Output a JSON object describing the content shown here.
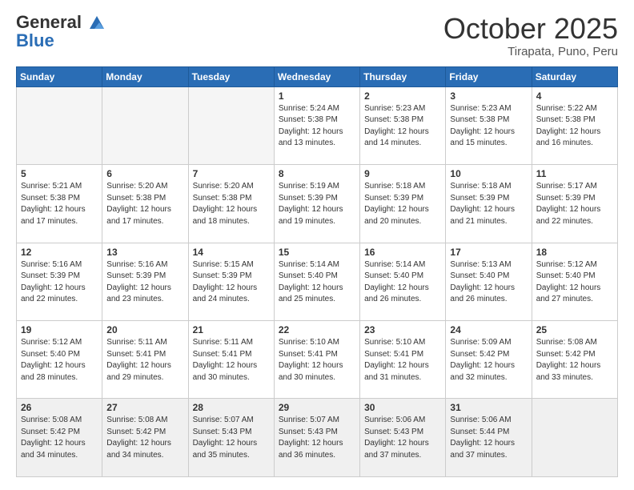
{
  "header": {
    "logo_general": "General",
    "logo_blue": "Blue",
    "month_title": "October 2025",
    "location": "Tirapata, Puno, Peru"
  },
  "days_of_week": [
    "Sunday",
    "Monday",
    "Tuesday",
    "Wednesday",
    "Thursday",
    "Friday",
    "Saturday"
  ],
  "weeks": [
    [
      {
        "day": "",
        "text": ""
      },
      {
        "day": "",
        "text": ""
      },
      {
        "day": "",
        "text": ""
      },
      {
        "day": "1",
        "text": "Sunrise: 5:24 AM\nSunset: 5:38 PM\nDaylight: 12 hours\nand 13 minutes."
      },
      {
        "day": "2",
        "text": "Sunrise: 5:23 AM\nSunset: 5:38 PM\nDaylight: 12 hours\nand 14 minutes."
      },
      {
        "day": "3",
        "text": "Sunrise: 5:23 AM\nSunset: 5:38 PM\nDaylight: 12 hours\nand 15 minutes."
      },
      {
        "day": "4",
        "text": "Sunrise: 5:22 AM\nSunset: 5:38 PM\nDaylight: 12 hours\nand 16 minutes."
      }
    ],
    [
      {
        "day": "5",
        "text": "Sunrise: 5:21 AM\nSunset: 5:38 PM\nDaylight: 12 hours\nand 17 minutes."
      },
      {
        "day": "6",
        "text": "Sunrise: 5:20 AM\nSunset: 5:38 PM\nDaylight: 12 hours\nand 17 minutes."
      },
      {
        "day": "7",
        "text": "Sunrise: 5:20 AM\nSunset: 5:38 PM\nDaylight: 12 hours\nand 18 minutes."
      },
      {
        "day": "8",
        "text": "Sunrise: 5:19 AM\nSunset: 5:39 PM\nDaylight: 12 hours\nand 19 minutes."
      },
      {
        "day": "9",
        "text": "Sunrise: 5:18 AM\nSunset: 5:39 PM\nDaylight: 12 hours\nand 20 minutes."
      },
      {
        "day": "10",
        "text": "Sunrise: 5:18 AM\nSunset: 5:39 PM\nDaylight: 12 hours\nand 21 minutes."
      },
      {
        "day": "11",
        "text": "Sunrise: 5:17 AM\nSunset: 5:39 PM\nDaylight: 12 hours\nand 22 minutes."
      }
    ],
    [
      {
        "day": "12",
        "text": "Sunrise: 5:16 AM\nSunset: 5:39 PM\nDaylight: 12 hours\nand 22 minutes."
      },
      {
        "day": "13",
        "text": "Sunrise: 5:16 AM\nSunset: 5:39 PM\nDaylight: 12 hours\nand 23 minutes."
      },
      {
        "day": "14",
        "text": "Sunrise: 5:15 AM\nSunset: 5:39 PM\nDaylight: 12 hours\nand 24 minutes."
      },
      {
        "day": "15",
        "text": "Sunrise: 5:14 AM\nSunset: 5:40 PM\nDaylight: 12 hours\nand 25 minutes."
      },
      {
        "day": "16",
        "text": "Sunrise: 5:14 AM\nSunset: 5:40 PM\nDaylight: 12 hours\nand 26 minutes."
      },
      {
        "day": "17",
        "text": "Sunrise: 5:13 AM\nSunset: 5:40 PM\nDaylight: 12 hours\nand 26 minutes."
      },
      {
        "day": "18",
        "text": "Sunrise: 5:12 AM\nSunset: 5:40 PM\nDaylight: 12 hours\nand 27 minutes."
      }
    ],
    [
      {
        "day": "19",
        "text": "Sunrise: 5:12 AM\nSunset: 5:40 PM\nDaylight: 12 hours\nand 28 minutes."
      },
      {
        "day": "20",
        "text": "Sunrise: 5:11 AM\nSunset: 5:41 PM\nDaylight: 12 hours\nand 29 minutes."
      },
      {
        "day": "21",
        "text": "Sunrise: 5:11 AM\nSunset: 5:41 PM\nDaylight: 12 hours\nand 30 minutes."
      },
      {
        "day": "22",
        "text": "Sunrise: 5:10 AM\nSunset: 5:41 PM\nDaylight: 12 hours\nand 30 minutes."
      },
      {
        "day": "23",
        "text": "Sunrise: 5:10 AM\nSunset: 5:41 PM\nDaylight: 12 hours\nand 31 minutes."
      },
      {
        "day": "24",
        "text": "Sunrise: 5:09 AM\nSunset: 5:42 PM\nDaylight: 12 hours\nand 32 minutes."
      },
      {
        "day": "25",
        "text": "Sunrise: 5:08 AM\nSunset: 5:42 PM\nDaylight: 12 hours\nand 33 minutes."
      }
    ],
    [
      {
        "day": "26",
        "text": "Sunrise: 5:08 AM\nSunset: 5:42 PM\nDaylight: 12 hours\nand 34 minutes."
      },
      {
        "day": "27",
        "text": "Sunrise: 5:08 AM\nSunset: 5:42 PM\nDaylight: 12 hours\nand 34 minutes."
      },
      {
        "day": "28",
        "text": "Sunrise: 5:07 AM\nSunset: 5:43 PM\nDaylight: 12 hours\nand 35 minutes."
      },
      {
        "day": "29",
        "text": "Sunrise: 5:07 AM\nSunset: 5:43 PM\nDaylight: 12 hours\nand 36 minutes."
      },
      {
        "day": "30",
        "text": "Sunrise: 5:06 AM\nSunset: 5:43 PM\nDaylight: 12 hours\nand 37 minutes."
      },
      {
        "day": "31",
        "text": "Sunrise: 5:06 AM\nSunset: 5:44 PM\nDaylight: 12 hours\nand 37 minutes."
      },
      {
        "day": "",
        "text": ""
      }
    ]
  ]
}
